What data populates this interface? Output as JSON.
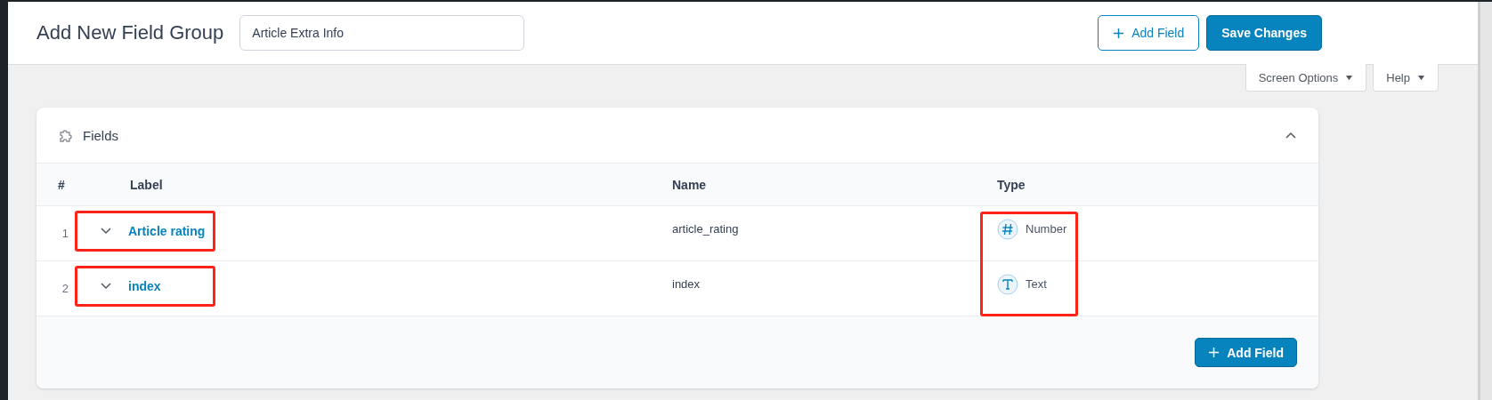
{
  "header": {
    "title": "Add New Field Group",
    "title_field": {
      "value": "Article Extra Info"
    },
    "buttons": [
      {
        "label": "Add Field",
        "kind": "outline"
      },
      {
        "label": "Save Changes",
        "kind": "primary"
      }
    ]
  },
  "screen_tabs": [
    "Screen Options",
    "Help"
  ],
  "fields_panel": {
    "title": "Fields",
    "expanded": true,
    "table": {
      "columns": [
        "#",
        "Label",
        "Name",
        "Type"
      ],
      "rows": [
        {
          "number": "1",
          "label": "Article rating",
          "name": "article_rating",
          "type": "Number",
          "kind": "number",
          "expanded": false,
          "label_highlighted": true
        },
        {
          "number": "2",
          "label": "index",
          "name": "index",
          "type": "Text",
          "kind": "text",
          "expanded": false,
          "label_highlighted": true
        }
      ],
      "type_column_highlighted": true
    },
    "footer_button": "Add Field"
  }
}
